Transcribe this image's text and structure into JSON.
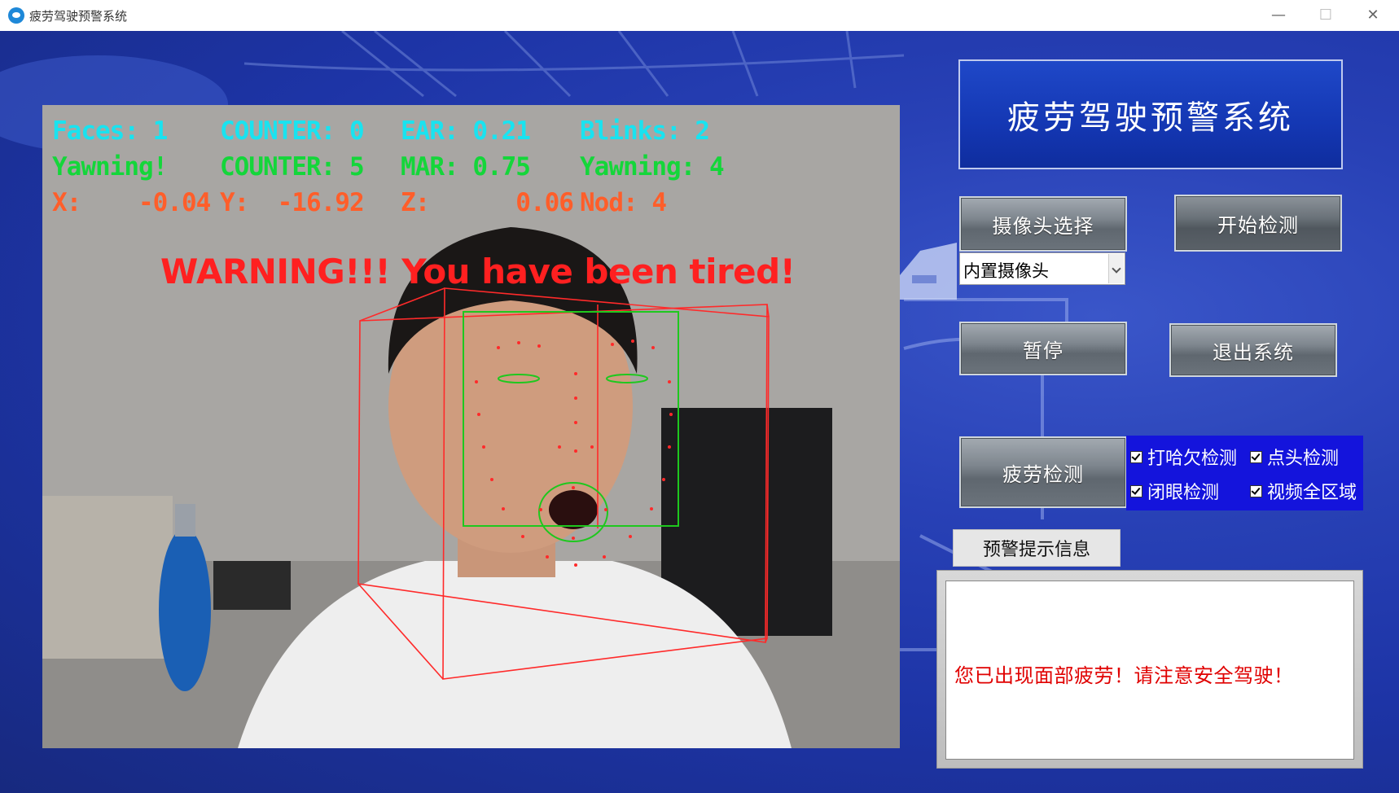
{
  "window": {
    "title": "疲劳驾驶预警系统",
    "minimize_glyph": "—",
    "maximize_glyph": "☐",
    "close_glyph": "✕"
  },
  "hud": {
    "faces": "Faces: 1",
    "counter_eye": "COUNTER: 0",
    "ear": "EAR: 0.21",
    "blinks": "Blinks: 2",
    "yawning_flag": "Yawning!",
    "counter_mouth": "COUNTER: 5",
    "mar": "MAR: 0.75",
    "yawning_count": "Yawning: 4",
    "x": "X:    -0.04",
    "y": "Y:  -16.92",
    "z": "Z:      0.06",
    "nod": "Nod: 4",
    "warning": "WARNING!!! You have been tired!"
  },
  "panel": {
    "header_title": "疲劳驾驶预警系统",
    "camera_select_button": "摄像头选择",
    "start_button": "开始检测",
    "camera_option": "内置摄像头",
    "pause_button": "暂停",
    "exit_button": "退出系统",
    "fatigue_button": "疲劳检测",
    "checks": [
      {
        "label": "打哈欠检测",
        "checked": true
      },
      {
        "label": "点头检测",
        "checked": true
      },
      {
        "label": "闭眼检测",
        "checked": true
      },
      {
        "label": "视频全区域",
        "checked": true
      }
    ],
    "alert_label": "预警提示信息",
    "alert_message": "您已出现面部疲劳！请注意安全驾驶！"
  },
  "colors": {
    "hud_cyan": "#19e3f0",
    "hud_green": "#14d63a",
    "hud_orange": "#ff5e2a",
    "warning_red": "#ff2020",
    "checkbox_panel": "#1414dc",
    "alert_text": "#e00000"
  }
}
